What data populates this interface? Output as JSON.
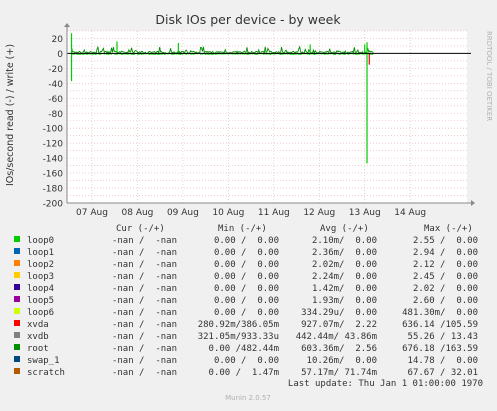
{
  "chart_data": {
    "type": "line",
    "title": "Disk IOs per device - by week",
    "ylabel": "IOs/second read (-) / write (+)",
    "side_label": "RRDTOOL / TOBI OETIKER",
    "footer": "Munin 2.0.57",
    "last_update": "Last update: Thu Jan  1 01:00:00 1970",
    "ylim": [
      -200,
      30
    ],
    "yticks": [
      30,
      20,
      10,
      0,
      -10,
      -20,
      -30,
      -40,
      -50,
      -60,
      -70,
      -80,
      -90,
      -100,
      -110,
      -120,
      -130,
      -140,
      -150,
      -160,
      -170,
      -180,
      -190,
      -200
    ],
    "ytick_labels": [
      "",
      "20",
      "",
      "0",
      "",
      "-20",
      "",
      "-40",
      "",
      "-60",
      "",
      "-80",
      "",
      "-100",
      "",
      "-120",
      "",
      "-140",
      "",
      "-160",
      "",
      "-180",
      "",
      "-200"
    ],
    "xlabels": [
      "07 Aug",
      "08 Aug",
      "09 Aug",
      "10 Aug",
      "11 Aug",
      "12 Aug",
      "13 Aug",
      "14 Aug"
    ],
    "xrange_days": [
      0,
      8.8
    ],
    "xlabel_days": [
      0.55,
      1.55,
      2.55,
      3.55,
      4.55,
      5.55,
      6.55,
      7.55
    ],
    "data_span_days": [
      0.1,
      6.75
    ],
    "spikes": [
      {
        "day": 0.1,
        "value": -37,
        "color": "#00cc00"
      },
      {
        "day": 0.1,
        "value": 27,
        "color": "#00cc00"
      },
      {
        "day": 6.6,
        "value": -147,
        "color": "#00cc00"
      },
      {
        "day": 6.6,
        "value": 15,
        "color": "#00cc00"
      },
      {
        "day": 6.55,
        "value": 12,
        "color": "#00cc00"
      },
      {
        "day": 6.65,
        "value": -15,
        "color": "#e00000"
      },
      {
        "day": 1.1,
        "value": 16,
        "color": "#00cc00"
      },
      {
        "day": 2.45,
        "value": 14,
        "color": "#00cc00"
      },
      {
        "day": 5.35,
        "value": 12,
        "color": "#00cc00"
      }
    ],
    "headers": {
      "cur": "Cur (-/+)",
      "min": "Min (-/+)",
      "avg": "Avg (-/+)",
      "max": "Max (-/+)"
    },
    "series": [
      {
        "name": "loop0",
        "color": "#00cc00",
        "cur": "-nan /  -nan",
        "min": "0.00 /  0.00",
        "avg": "2.10m/  0.00",
        "max": "2.55 /  0.00"
      },
      {
        "name": "loop1",
        "color": "#0066b3",
        "cur": "-nan /  -nan",
        "min": "0.00 /  0.00",
        "avg": "2.36m/  0.00",
        "max": "2.94 /  0.00"
      },
      {
        "name": "loop2",
        "color": "#ff8000",
        "cur": "-nan /  -nan",
        "min": "0.00 /  0.00",
        "avg": "2.02m/  0.00",
        "max": "2.12 /  0.00"
      },
      {
        "name": "loop3",
        "color": "#ffcc00",
        "cur": "-nan /  -nan",
        "min": "0.00 /  0.00",
        "avg": "2.24m/  0.00",
        "max": "2.45 /  0.00"
      },
      {
        "name": "loop4",
        "color": "#330099",
        "cur": "-nan /  -nan",
        "min": "0.00 /  0.00",
        "avg": "1.42m/  0.00",
        "max": "2.02 /  0.00"
      },
      {
        "name": "loop5",
        "color": "#990099",
        "cur": "-nan /  -nan",
        "min": "0.00 /  0.00",
        "avg": "1.93m/  0.00",
        "max": "2.60 /  0.00"
      },
      {
        "name": "loop6",
        "color": "#ccff00",
        "cur": "-nan /  -nan",
        "min": "0.00 /  0.00",
        "avg": "334.29u/  0.00",
        "max": "481.30m/  0.00"
      },
      {
        "name": "xvda",
        "color": "#ff0000",
        "cur": "-nan /  -nan",
        "min": "280.92m/386.05m",
        "avg": "927.07m/  2.22",
        "max": "636.14 /105.59"
      },
      {
        "name": "xvdb",
        "color": "#808080",
        "cur": "-nan /  -nan",
        "min": "321.05m/933.33u",
        "avg": "442.44m/ 43.86m",
        "max": "55.26 / 13.43"
      },
      {
        "name": "root",
        "color": "#008f00",
        "cur": "-nan /  -nan",
        "min": "0.00 /482.44m",
        "avg": "603.36m/  2.56",
        "max": "676.18 /163.59"
      },
      {
        "name": "swap_1",
        "color": "#00487d",
        "cur": "-nan /  -nan",
        "min": "0.00 /  0.00",
        "avg": "10.26m/  0.00",
        "max": "14.78 /  0.00"
      },
      {
        "name": "scratch",
        "color": "#b35a00",
        "cur": "-nan /  -nan",
        "min": "0.00 /  1.47m",
        "avg": "57.17m/ 71.74m",
        "max": "67.67 / 32.01"
      }
    ]
  }
}
